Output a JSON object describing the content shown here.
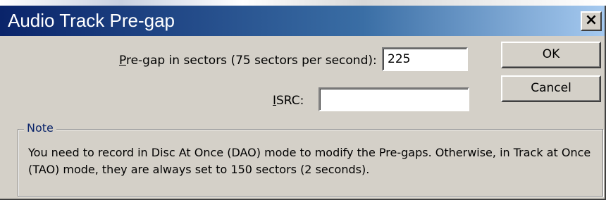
{
  "window": {
    "title": "Audio Track Pre-gap",
    "close_glyph": "×"
  },
  "pregap": {
    "label_accel": "P",
    "label_rest": "re-gap in sectors (75 sectors per second):",
    "value": "225"
  },
  "isrc": {
    "label_accel": "I",
    "label_rest": "SRC:",
    "value": ""
  },
  "buttons": {
    "ok": "OK",
    "cancel": "Cancel"
  },
  "note": {
    "legend": "Note",
    "text": "You need to record in Disc At Once (DAO) mode to modify the Pre-gaps. Otherwise, in Track at Once (TAO) mode, they are always set to 150 sectors (2 seconds)."
  },
  "colors": {
    "titlebar_start": "#0a246a",
    "titlebar_end": "#a6caf0",
    "dialog_face": "#d4d0c8",
    "legend_text": "#0a246a"
  }
}
